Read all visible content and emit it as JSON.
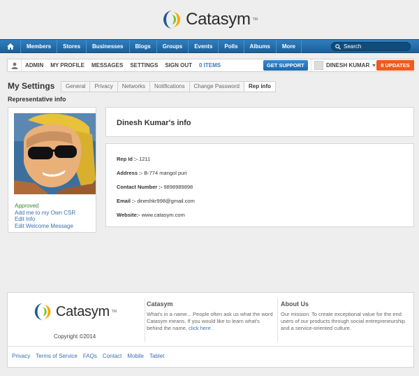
{
  "brand": {
    "name": "Catasym",
    "tm": "TM"
  },
  "nav": {
    "items": [
      "Members",
      "Stores",
      "Businesses",
      "Blogs",
      "Groups",
      "Events",
      "Polls",
      "Albums",
      "More"
    ],
    "search_placeholder": "Search"
  },
  "userbar": {
    "links": [
      "ADMIN",
      "MY PROFILE",
      "MESSAGES",
      "SETTINGS",
      "SIGN OUT"
    ],
    "items_count": "0 ITEMS",
    "support": "GET SUPPORT",
    "user_name": "DINESH KUMAR",
    "updates": "8 UPDATES"
  },
  "settings": {
    "title": "My Settings",
    "tabs": [
      "General",
      "Privacy",
      "Networks",
      "Notifications",
      "Change Password",
      "Rep info"
    ],
    "active_tab": "Rep info",
    "section": "Representative info"
  },
  "left_card": {
    "status": "Approved",
    "links": [
      "Add me to my Own CSR",
      "Edit Info",
      "Edit Welcome Message"
    ]
  },
  "info": {
    "title": "Dinesh Kumar's info",
    "rows": [
      {
        "label": "Rep Id :-",
        "value": "1211"
      },
      {
        "label": "Address :-",
        "value": "B-774 mangol puri"
      },
      {
        "label": "Contact Number :-",
        "value": "9898989898"
      },
      {
        "label": "Email :-",
        "value": "dineshkr998@gmail.com"
      },
      {
        "label": "Website:-",
        "value": "www.catasym.com"
      }
    ]
  },
  "footer": {
    "copyright": "Copyright ©2014",
    "catasym": {
      "heading": "Catasym",
      "text": "What's in a name... People often ask us what the word Catasym means. If you would like to learn what's behind the name,",
      "link": "click here",
      "after": "."
    },
    "about": {
      "heading": "About Us",
      "text": "Our mission: To create exceptional value for the end users of our products through social entrepreneurship and a service-oriented culture."
    },
    "links": [
      "Privacy",
      "Terms of Service",
      "FAQs",
      "Contact",
      "Mobile",
      "Tablet"
    ]
  },
  "colors": {
    "nav": "#1d5f98",
    "updates": "#f05a1e",
    "link": "#3a6fb0",
    "approved": "#2a8a2a"
  }
}
